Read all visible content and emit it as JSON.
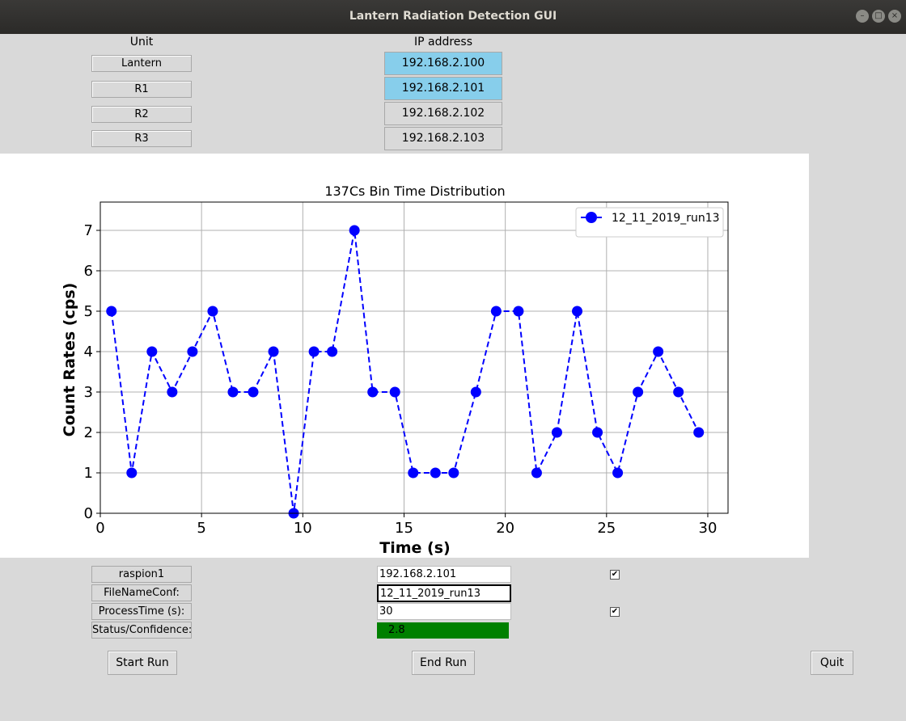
{
  "window": {
    "title": "Lantern Radiation Detection GUI"
  },
  "headers": {
    "unit": "Unit",
    "ip": "IP address"
  },
  "units": [
    "Lantern",
    "R1",
    "R2",
    "R3"
  ],
  "ips": [
    "192.168.2.100",
    "192.168.2.101",
    "192.168.2.102",
    "192.168.2.103"
  ],
  "ip_highlight": [
    true,
    true,
    false,
    false
  ],
  "highlight_color": "#87ceeb",
  "chart_data": {
    "type": "line",
    "title": "137Cs Bin Time Distribution",
    "xlabel": "Time (s)",
    "ylabel": "Count Rates (cps)",
    "xlim": [
      0,
      31
    ],
    "ylim": [
      0,
      7.7
    ],
    "xticks": [
      0,
      5,
      10,
      15,
      20,
      25,
      30
    ],
    "yticks": [
      0,
      1,
      2,
      3,
      4,
      5,
      6,
      7
    ],
    "grid": true,
    "legend_position": "top-right",
    "series": [
      {
        "name": "12_11_2019_run13",
        "color": "#0000ff",
        "style": "dashed-with-circles",
        "x": [
          0.55,
          1.55,
          2.55,
          3.55,
          4.55,
          5.55,
          6.55,
          7.55,
          8.55,
          9.55,
          10.55,
          11.45,
          12.55,
          13.45,
          14.55,
          15.45,
          16.55,
          17.45,
          18.55,
          19.55,
          20.65,
          21.55,
          22.55,
          23.55,
          24.55,
          25.55,
          26.55,
          27.55,
          28.55,
          29.55
        ],
        "y": [
          5,
          1,
          4,
          3,
          4,
          5,
          3,
          3,
          4,
          0,
          4,
          4,
          7,
          3,
          3,
          1,
          1,
          1,
          3,
          5,
          5,
          1,
          2,
          5,
          2,
          1,
          3,
          4,
          3,
          2
        ]
      }
    ]
  },
  "controls": {
    "device_label": "raspion1",
    "device_ip": "192.168.2.101",
    "filename_label": "FileNameConf:",
    "filename_value": "12_11_2019_run13",
    "process_label": "ProcessTime (s):",
    "process_value": "30",
    "status_label": "Status/Confidence:",
    "status_value": "2.8",
    "status_color": "#008000",
    "check_mark": "✔"
  },
  "buttons": {
    "start": "Start Run",
    "end": "End Run",
    "quit": "Quit"
  }
}
